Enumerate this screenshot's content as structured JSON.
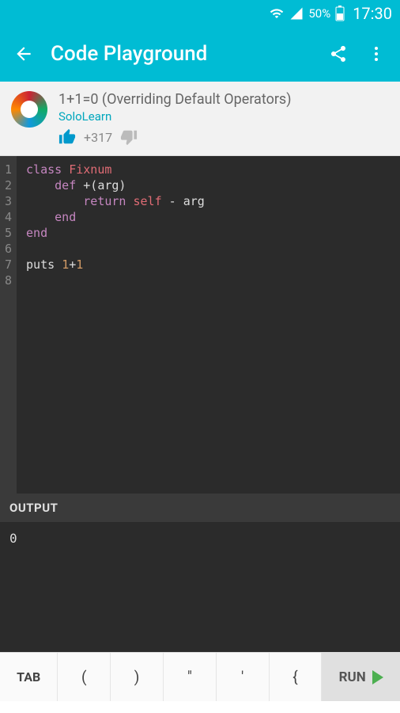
{
  "status": {
    "battery_pct": "50%",
    "time": "17:30"
  },
  "appbar": {
    "title": "Code Playground"
  },
  "post": {
    "title": "1+1=0 (Overriding Default Operators)",
    "author": "SoloLearn",
    "votes": "+317"
  },
  "code": {
    "lines": [
      "1",
      "2",
      "3",
      "4",
      "5",
      "6",
      "7",
      "8"
    ],
    "tokens": [
      [
        {
          "t": "class ",
          "c": "kw"
        },
        {
          "t": "Fixnum",
          "c": "cls"
        }
      ],
      [
        {
          "t": "    ",
          "c": ""
        },
        {
          "t": "def ",
          "c": "kw"
        },
        {
          "t": "+(arg)",
          "c": ""
        }
      ],
      [
        {
          "t": "        ",
          "c": ""
        },
        {
          "t": "return ",
          "c": "kw"
        },
        {
          "t": "self",
          "c": "self"
        },
        {
          "t": " - arg",
          "c": ""
        }
      ],
      [
        {
          "t": "    ",
          "c": ""
        },
        {
          "t": "end",
          "c": "kw"
        }
      ],
      [
        {
          "t": "end",
          "c": "kw"
        }
      ],
      [],
      [
        {
          "t": "puts ",
          "c": ""
        },
        {
          "t": "1",
          "c": "num"
        },
        {
          "t": "+",
          "c": ""
        },
        {
          "t": "1",
          "c": "num"
        }
      ],
      []
    ]
  },
  "output": {
    "label": "OUTPUT",
    "text": "0"
  },
  "bottom": {
    "tab": "TAB",
    "k1": "(",
    "k2": ")",
    "k3": "\"",
    "k4": "'",
    "k5": "{",
    "run": "RUN"
  }
}
